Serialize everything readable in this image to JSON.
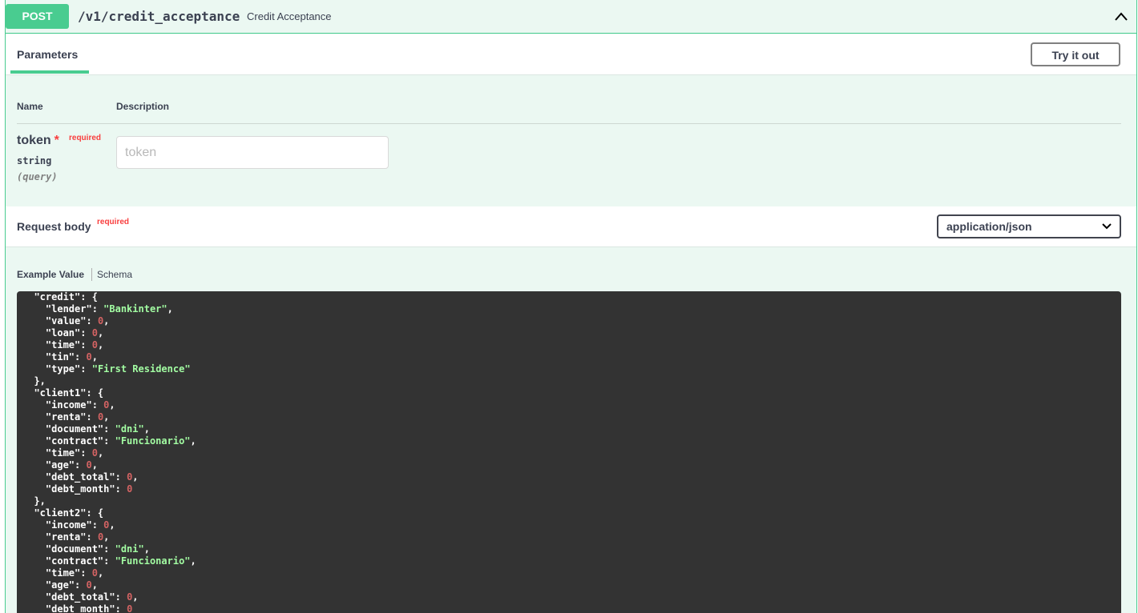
{
  "summary": {
    "method": "POST",
    "path": "/v1/credit_acceptance",
    "description": "Credit Acceptance"
  },
  "parameters": {
    "tab_label": "Parameters",
    "try_label": "Try it out",
    "col_name": "Name",
    "col_description": "Description",
    "items": [
      {
        "name": "token",
        "required_label": "required",
        "type": "string",
        "in": "(query)",
        "placeholder": "token"
      }
    ]
  },
  "request_body": {
    "title": "Request body",
    "required_label": "required",
    "content_type": "application/json",
    "example_tab": "Example Value",
    "schema_tab": "Schema",
    "lines": [
      {
        "indent": 2,
        "tokens": [
          [
            "k",
            "\"credit\""
          ],
          [
            "p",
            ": {"
          ]
        ]
      },
      {
        "indent": 4,
        "tokens": [
          [
            "k",
            "\"lender\""
          ],
          [
            "p",
            ": "
          ],
          [
            "s",
            "\"Bankinter\""
          ],
          [
            "p",
            ","
          ]
        ]
      },
      {
        "indent": 4,
        "tokens": [
          [
            "k",
            "\"value\""
          ],
          [
            "p",
            ": "
          ],
          [
            "n",
            "0"
          ],
          [
            "p",
            ","
          ]
        ]
      },
      {
        "indent": 4,
        "tokens": [
          [
            "k",
            "\"loan\""
          ],
          [
            "p",
            ": "
          ],
          [
            "n",
            "0"
          ],
          [
            "p",
            ","
          ]
        ]
      },
      {
        "indent": 4,
        "tokens": [
          [
            "k",
            "\"time\""
          ],
          [
            "p",
            ": "
          ],
          [
            "n",
            "0"
          ],
          [
            "p",
            ","
          ]
        ]
      },
      {
        "indent": 4,
        "tokens": [
          [
            "k",
            "\"tin\""
          ],
          [
            "p",
            ": "
          ],
          [
            "n",
            "0"
          ],
          [
            "p",
            ","
          ]
        ]
      },
      {
        "indent": 4,
        "tokens": [
          [
            "k",
            "\"type\""
          ],
          [
            "p",
            ": "
          ],
          [
            "s",
            "\"First Residence\""
          ]
        ]
      },
      {
        "indent": 2,
        "tokens": [
          [
            "p",
            "},"
          ]
        ]
      },
      {
        "indent": 2,
        "tokens": [
          [
            "k",
            "\"client1\""
          ],
          [
            "p",
            ": {"
          ]
        ]
      },
      {
        "indent": 4,
        "tokens": [
          [
            "k",
            "\"income\""
          ],
          [
            "p",
            ": "
          ],
          [
            "n",
            "0"
          ],
          [
            "p",
            ","
          ]
        ]
      },
      {
        "indent": 4,
        "tokens": [
          [
            "k",
            "\"renta\""
          ],
          [
            "p",
            ": "
          ],
          [
            "n",
            "0"
          ],
          [
            "p",
            ","
          ]
        ]
      },
      {
        "indent": 4,
        "tokens": [
          [
            "k",
            "\"document\""
          ],
          [
            "p",
            ": "
          ],
          [
            "s",
            "\"dni\""
          ],
          [
            "p",
            ","
          ]
        ]
      },
      {
        "indent": 4,
        "tokens": [
          [
            "k",
            "\"contract\""
          ],
          [
            "p",
            ": "
          ],
          [
            "s",
            "\"Funcionario\""
          ],
          [
            "p",
            ","
          ]
        ]
      },
      {
        "indent": 4,
        "tokens": [
          [
            "k",
            "\"time\""
          ],
          [
            "p",
            ": "
          ],
          [
            "n",
            "0"
          ],
          [
            "p",
            ","
          ]
        ]
      },
      {
        "indent": 4,
        "tokens": [
          [
            "k",
            "\"age\""
          ],
          [
            "p",
            ": "
          ],
          [
            "n",
            "0"
          ],
          [
            "p",
            ","
          ]
        ]
      },
      {
        "indent": 4,
        "tokens": [
          [
            "k",
            "\"debt_total\""
          ],
          [
            "p",
            ": "
          ],
          [
            "n",
            "0"
          ],
          [
            "p",
            ","
          ]
        ]
      },
      {
        "indent": 4,
        "tokens": [
          [
            "k",
            "\"debt_month\""
          ],
          [
            "p",
            ": "
          ],
          [
            "n",
            "0"
          ]
        ]
      },
      {
        "indent": 2,
        "tokens": [
          [
            "p",
            "},"
          ]
        ]
      },
      {
        "indent": 2,
        "tokens": [
          [
            "k",
            "\"client2\""
          ],
          [
            "p",
            ": {"
          ]
        ]
      },
      {
        "indent": 4,
        "tokens": [
          [
            "k",
            "\"income\""
          ],
          [
            "p",
            ": "
          ],
          [
            "n",
            "0"
          ],
          [
            "p",
            ","
          ]
        ]
      },
      {
        "indent": 4,
        "tokens": [
          [
            "k",
            "\"renta\""
          ],
          [
            "p",
            ": "
          ],
          [
            "n",
            "0"
          ],
          [
            "p",
            ","
          ]
        ]
      },
      {
        "indent": 4,
        "tokens": [
          [
            "k",
            "\"document\""
          ],
          [
            "p",
            ": "
          ],
          [
            "s",
            "\"dni\""
          ],
          [
            "p",
            ","
          ]
        ]
      },
      {
        "indent": 4,
        "tokens": [
          [
            "k",
            "\"contract\""
          ],
          [
            "p",
            ": "
          ],
          [
            "s",
            "\"Funcionario\""
          ],
          [
            "p",
            ","
          ]
        ]
      },
      {
        "indent": 4,
        "tokens": [
          [
            "k",
            "\"time\""
          ],
          [
            "p",
            ": "
          ],
          [
            "n",
            "0"
          ],
          [
            "p",
            ","
          ]
        ]
      },
      {
        "indent": 4,
        "tokens": [
          [
            "k",
            "\"age\""
          ],
          [
            "p",
            ": "
          ],
          [
            "n",
            "0"
          ],
          [
            "p",
            ","
          ]
        ]
      },
      {
        "indent": 4,
        "tokens": [
          [
            "k",
            "\"debt_total\""
          ],
          [
            "p",
            ": "
          ],
          [
            "n",
            "0"
          ],
          [
            "p",
            ","
          ]
        ]
      },
      {
        "indent": 4,
        "tokens": [
          [
            "k",
            "\"debt_month\""
          ],
          [
            "p",
            ": "
          ],
          [
            "n",
            "0"
          ]
        ]
      }
    ]
  },
  "colors": {
    "post": "#49cc90",
    "required": "#f93e3e",
    "json_string": "#a2fca2",
    "json_number": "#d36363"
  },
  "icons": {
    "collapse": "chevron-up-icon",
    "select": "chevron-down-icon"
  }
}
